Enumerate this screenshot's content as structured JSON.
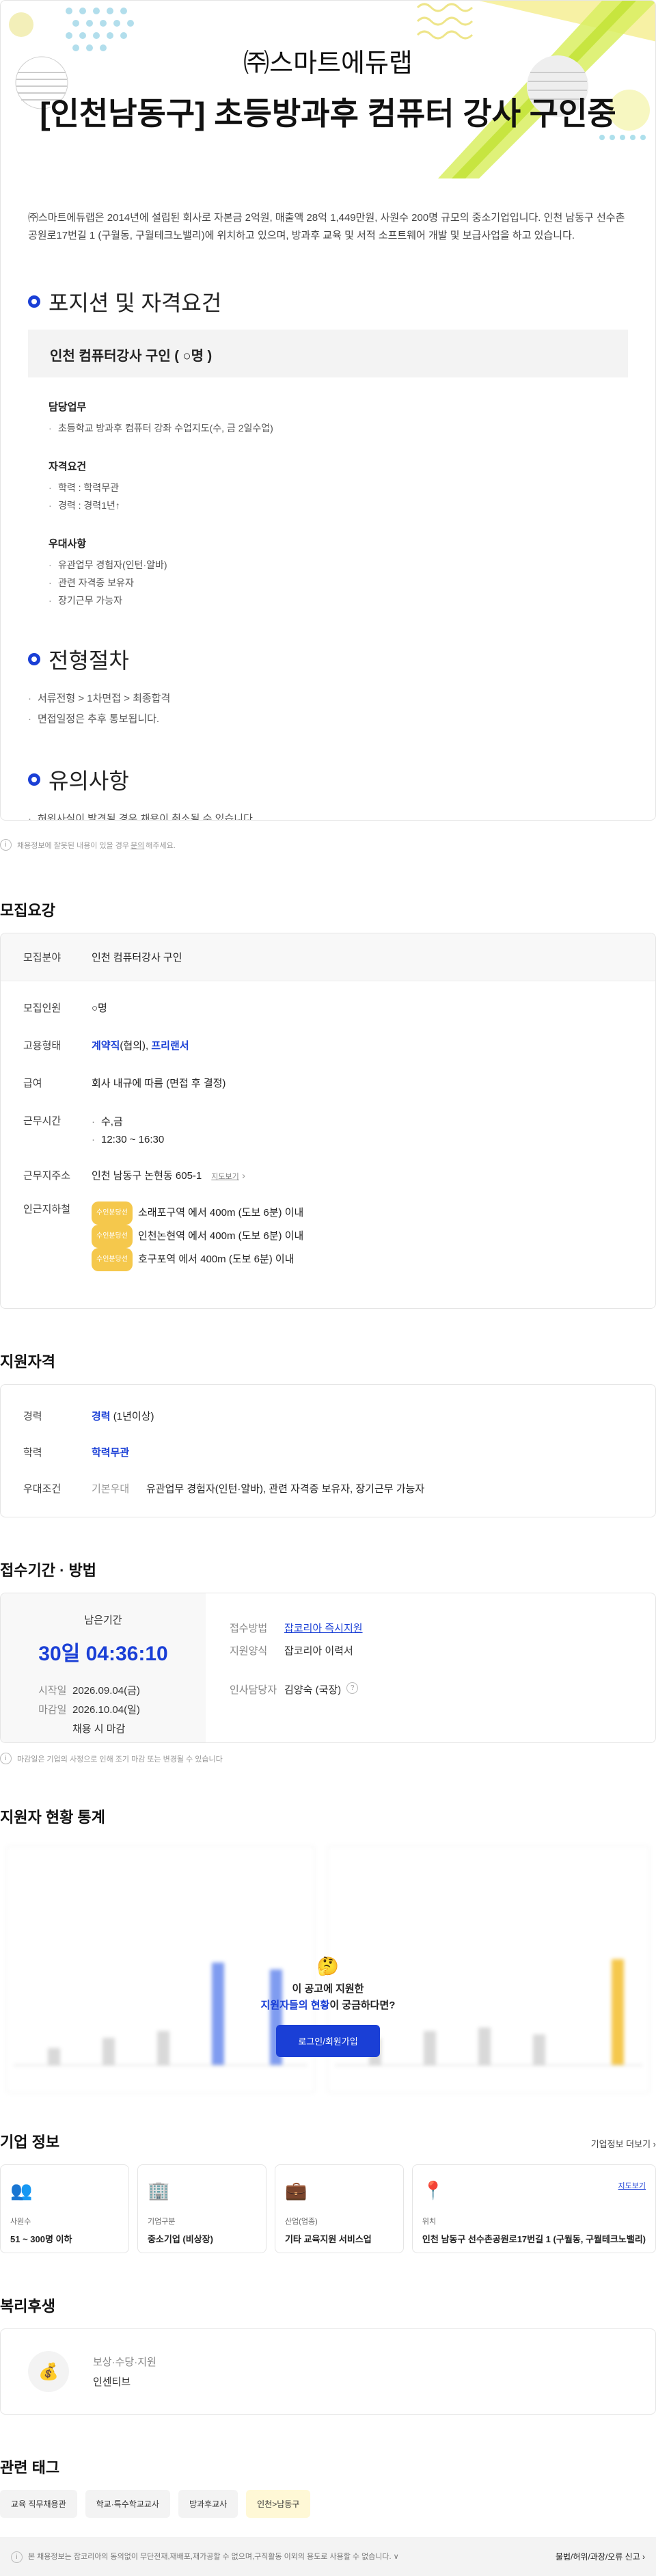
{
  "hero": {
    "company": "㈜스마트에듀랩",
    "title": "[인천남동구] 초등방과후 컴퓨터 강사 구인중"
  },
  "intro": "㈜스마트에듀랩은 2014년에 설립된 회사로 자본금 2억원, 매출액 28억 1,449만원, 사원수 200명 규모의 중소기업입니다. 인천 남동구 선수촌공원로17번길 1 (구월동, 구월테크노밸리)에 위치하고 있으며, 방과후 교육 및 서적 소프트웨어 개발 및 보급사업을 하고 있습니다.",
  "positions": {
    "heading": "포지션 및 자격요건",
    "box": "인천 컴퓨터강사 구인 ( ○명 )",
    "groups": [
      {
        "title": "담당업무",
        "items": [
          "초등학교 방과후 컴퓨터 강좌 수업지도(수, 금 2일수업)"
        ]
      },
      {
        "title": "자격요건",
        "items": [
          "학력 : 학력무관",
          "경력 : 경력1년↑"
        ]
      },
      {
        "title": "우대사항",
        "items": [
          "유관업무 경험자(인턴·알바)",
          "관련 자격증 보유자",
          "장기근무 가능자"
        ]
      }
    ]
  },
  "process": {
    "heading": "전형절차",
    "items": [
      "서류전형 > 1차면접 > 최종합격",
      "면접일정은 추후 통보됩니다."
    ]
  },
  "caution": {
    "heading": "유의사항",
    "items": [
      "허위사실이 발견될 경우 채용이 취소될 수 있습니다."
    ]
  },
  "notice": {
    "pre": "채용정보에 잘못된 내용이 있을 경우",
    "link": "문의",
    "post": "해주세요."
  },
  "summary": {
    "title": "모집요강",
    "field_label": "모집분야",
    "field": "인천 컴퓨터강사 구인",
    "count_label": "모집인원",
    "count": "○명",
    "type_label": "고용형태",
    "type1": "계약직",
    "type1_suffix": "(협의),",
    "type2": "프리랜서",
    "salary_label": "급여",
    "salary": "회사 내규에 따름 (면접 후 결정)",
    "hours_label": "근무시간",
    "hours": [
      "수,금",
      "12:30 ~ 16:30"
    ],
    "addr_label": "근무지주소",
    "addr": "인천 남동구 논현동 605-1",
    "map": "지도보기",
    "subway_label": "인근지하철",
    "subway_badge": "수인분당선",
    "subway": [
      "소래포구역 에서 400m (도보 6분) 이내",
      "인천논현역 에서 400m (도보 6분) 이내",
      "호구포역 에서 400m (도보 6분) 이내"
    ]
  },
  "qual": {
    "title": "지원자격",
    "exp_label": "경력",
    "exp": "경력",
    "exp_note": "(1년이상)",
    "edu_label": "학력",
    "edu": "학력무관",
    "pref_label": "우대조건",
    "pref_sub": "기본우대",
    "pref": "유관업무 경험자(인턴·알바), 관련 자격증 보유자, 장기근무 가능자"
  },
  "period": {
    "title": "접수기간 · 방법",
    "remain_label": "남은기간",
    "remain": "30일 04:36:10",
    "start_label": "시작일",
    "start": "2026.09.04(금)",
    "end_label": "마감일",
    "end": "2026.10.04(일)",
    "end_note": "채용 시 마감",
    "method_label": "접수방법",
    "method": "잡코리아 즉시지원",
    "form_label": "지원양식",
    "form": "잡코리아 이력서",
    "manager_label": "인사담당자",
    "manager": "김양숙 (국장)",
    "note": "마감일은 기업의 사정으로 인해 조기 마감 또는 변경될 수 있습니다"
  },
  "stats": {
    "title": "지원자 현황 통계",
    "emoji": "🤔",
    "q1": "이 공고에 지원한",
    "q2_blue": "지원자들의 현황",
    "q2_rest": "이 궁금하다면?",
    "login": "로그인/회원가입"
  },
  "company": {
    "title": "기업 정보",
    "more": "기업정보 더보기 ›",
    "cards": [
      {
        "icon": "👥",
        "label": "사원수",
        "value": "51 ~ 300명 이하"
      },
      {
        "icon": "🏢",
        "label": "기업구분",
        "value": "중소기업 (비상장)"
      },
      {
        "icon": "💼",
        "label": "산업(업종)",
        "value": "기타 교육지원 서비스업"
      },
      {
        "icon": "📍",
        "label": "위치",
        "value": "인천 남동구 선수촌공원로17번길 1 (구월동, 구월테크노밸리)",
        "map": "지도보기"
      }
    ]
  },
  "welfare": {
    "title": "복리후생",
    "icon": "💰",
    "label": "보상·수당·지원",
    "value": "인센티브"
  },
  "tags": {
    "title": "관련 태그",
    "items": [
      "교육 직무채용관",
      "학교·특수학교교사",
      "방과후교사",
      "인천>남동구"
    ]
  },
  "footer": {
    "text": "본 채용정보는 잡코리아의 동의없이 무단전재,재배포,재가공할 수 없으며,구직활동 이외의 용도로 사용할 수 없습니다. ∨",
    "report": "불법/허위/과장/오류 신고 ›"
  },
  "colors": {
    "accent": "#1a3fd6",
    "metro_badge": "#f5c84c"
  }
}
